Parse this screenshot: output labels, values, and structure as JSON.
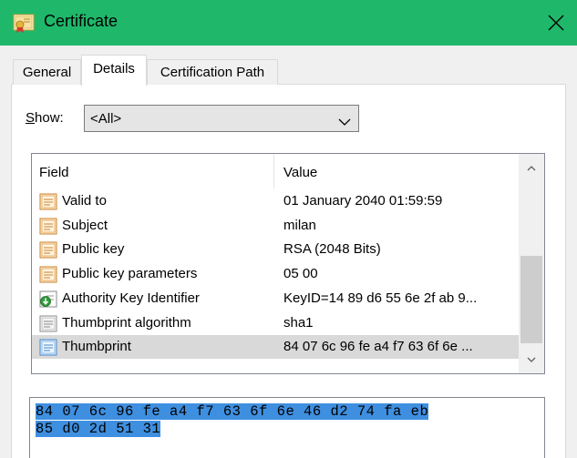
{
  "window": {
    "title": "Certificate",
    "accent_color": "#1fb86a",
    "icons": {
      "title": "certificate-icon",
      "close": "close-icon"
    }
  },
  "tabs": [
    {
      "label": "General",
      "selected": false
    },
    {
      "label": "Details",
      "selected": true
    },
    {
      "label": "Certification Path",
      "selected": false
    }
  ],
  "show": {
    "label_mnemonic": "S",
    "label_rest": "how:",
    "selected": "<All>"
  },
  "list": {
    "columns": {
      "field": "Field",
      "value": "Value"
    },
    "rows": [
      {
        "field": "Valid to",
        "value": "01 January 2040 01:59:59",
        "icon": "certificate-field-icon"
      },
      {
        "field": "Subject",
        "value": "milan",
        "icon": "certificate-field-icon"
      },
      {
        "field": "Public key",
        "value": "RSA (2048 Bits)",
        "icon": "certificate-field-icon"
      },
      {
        "field": "Public key parameters",
        "value": "05 00",
        "icon": "certificate-field-icon"
      },
      {
        "field": "Authority Key Identifier",
        "value": "KeyID=14 89 d6 55 6e 2f ab 9...",
        "icon": "extension-download-icon"
      },
      {
        "field": "Thumbprint algorithm",
        "value": "sha1",
        "icon": "property-field-icon"
      },
      {
        "field": "Thumbprint",
        "value": "84 07 6c 96 fe a4 f7 63 6f 6e ...",
        "icon": "property-field-icon",
        "selected": true
      }
    ]
  },
  "detail": {
    "line1": "84 07 6c 96 fe a4 f7 63 6f 6e 46 d2 74 fa eb",
    "line2": "85 d0 2d 51 31",
    "selection_color": "#3f8fe0"
  }
}
